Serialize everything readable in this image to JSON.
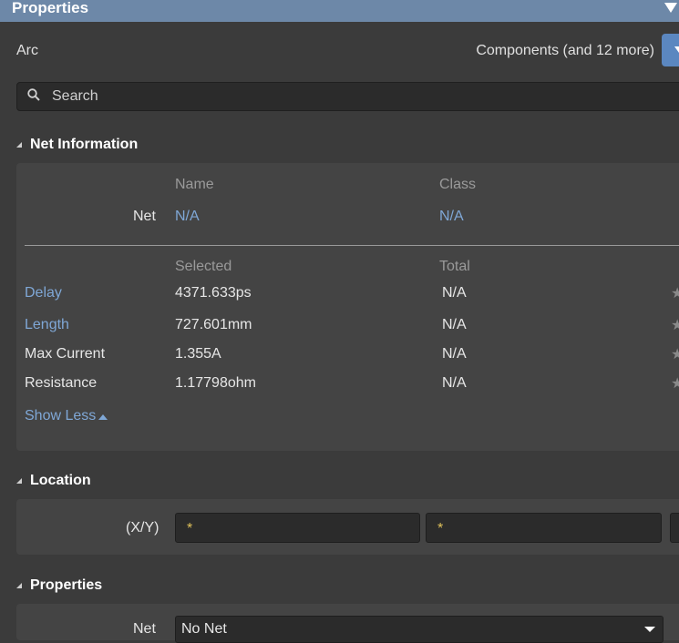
{
  "panel_title": "Properties",
  "object_type": "Arc",
  "filter_label": "Components (and 12 more)",
  "search": {
    "placeholder": "Search"
  },
  "net_information": {
    "title": "Net Information",
    "name_header": "Name",
    "class_header": "Class",
    "net_label": "Net",
    "net_name": "N/A",
    "net_class": "N/A",
    "selected_header": "Selected",
    "total_header": "Total",
    "rows": [
      {
        "label": "Delay",
        "selected": "4371.633ps",
        "total": "N/A",
        "label_is_link": true
      },
      {
        "label": "Length",
        "selected": "727.601mm",
        "total": "N/A",
        "label_is_link": true
      },
      {
        "label": "Max Current",
        "selected": "1.355A",
        "total": "N/A",
        "label_is_link": false
      },
      {
        "label": "Resistance",
        "selected": "1.17798ohm",
        "total": "N/A",
        "label_is_link": false
      }
    ],
    "show_less": "Show Less"
  },
  "location": {
    "title": "Location",
    "xy_label": "(X/Y)",
    "x_value": "*",
    "y_value": "*"
  },
  "properties": {
    "title": "Properties",
    "net_label": "Net",
    "net_value": "No Net"
  },
  "icons": {
    "collapse": "triangle-down-icon",
    "filter": "chevron-down-icon",
    "search": "search-icon",
    "section": "section-collapse-icon",
    "star": "star-icon",
    "show_less": "caret-up-icon"
  },
  "colors": {
    "accent": "#6d88a8",
    "link": "#7fa7d6",
    "background": "#3b3b3b",
    "panel": "#444444",
    "field": "#2b2b2b"
  }
}
